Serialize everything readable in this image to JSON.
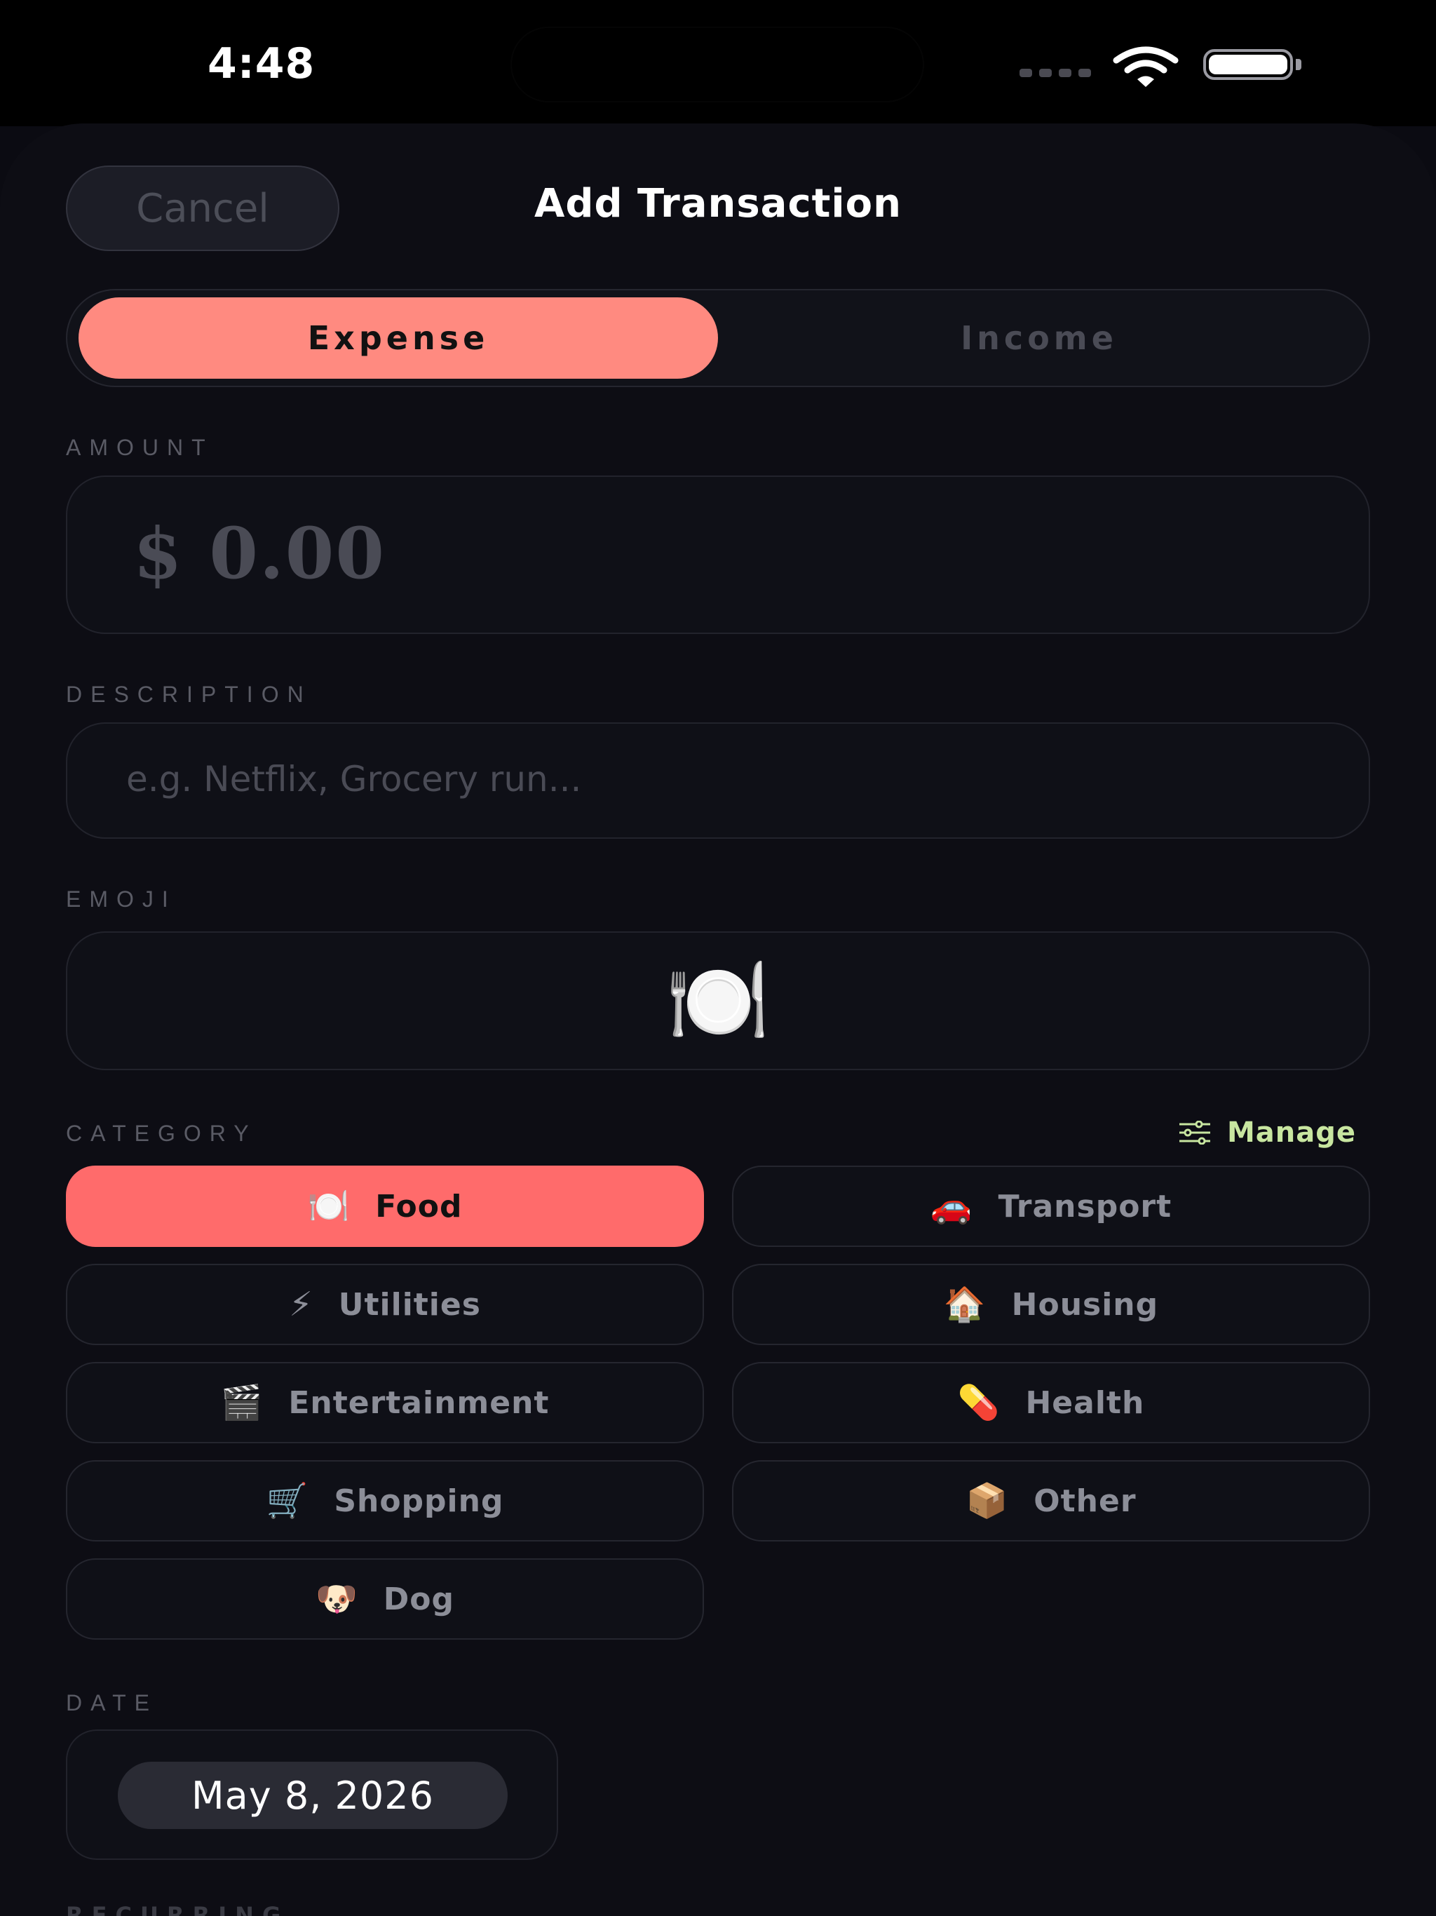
{
  "status_bar": {
    "time": "4:48"
  },
  "header": {
    "cancel_label": "Cancel",
    "title": "Add Transaction"
  },
  "type_toggle": {
    "expense_label": "Expense",
    "income_label": "Income",
    "selected": "Expense"
  },
  "amount": {
    "label": "AMOUNT",
    "value": "$ 0.00"
  },
  "description": {
    "label": "DESCRIPTION",
    "placeholder": "e.g. Netflix, Grocery run..."
  },
  "emoji": {
    "label": "EMOJI",
    "value": "🍽️"
  },
  "category": {
    "label": "CATEGORY",
    "manage_label": "Manage",
    "selected": "Food",
    "items": [
      {
        "emoji": "🍽️",
        "label": "Food"
      },
      {
        "emoji": "🚗",
        "label": "Transport"
      },
      {
        "emoji": "⚡",
        "label": "Utilities"
      },
      {
        "emoji": "🏠",
        "label": "Housing"
      },
      {
        "emoji": "🎬",
        "label": "Entertainment"
      },
      {
        "emoji": "💊",
        "label": "Health"
      },
      {
        "emoji": "🛒",
        "label": "Shopping"
      },
      {
        "emoji": "📦",
        "label": "Other"
      },
      {
        "emoji": "🐶",
        "label": "Dog"
      }
    ]
  },
  "date": {
    "label": "DATE",
    "value": "May 8, 2026"
  },
  "next_section": {
    "label": "RECURRING"
  },
  "colors": {
    "accent_expense": "#ff8a80",
    "accent_category": "#ff6b6b",
    "manage_green": "#c8e6a0",
    "background": "#0b0b12"
  }
}
